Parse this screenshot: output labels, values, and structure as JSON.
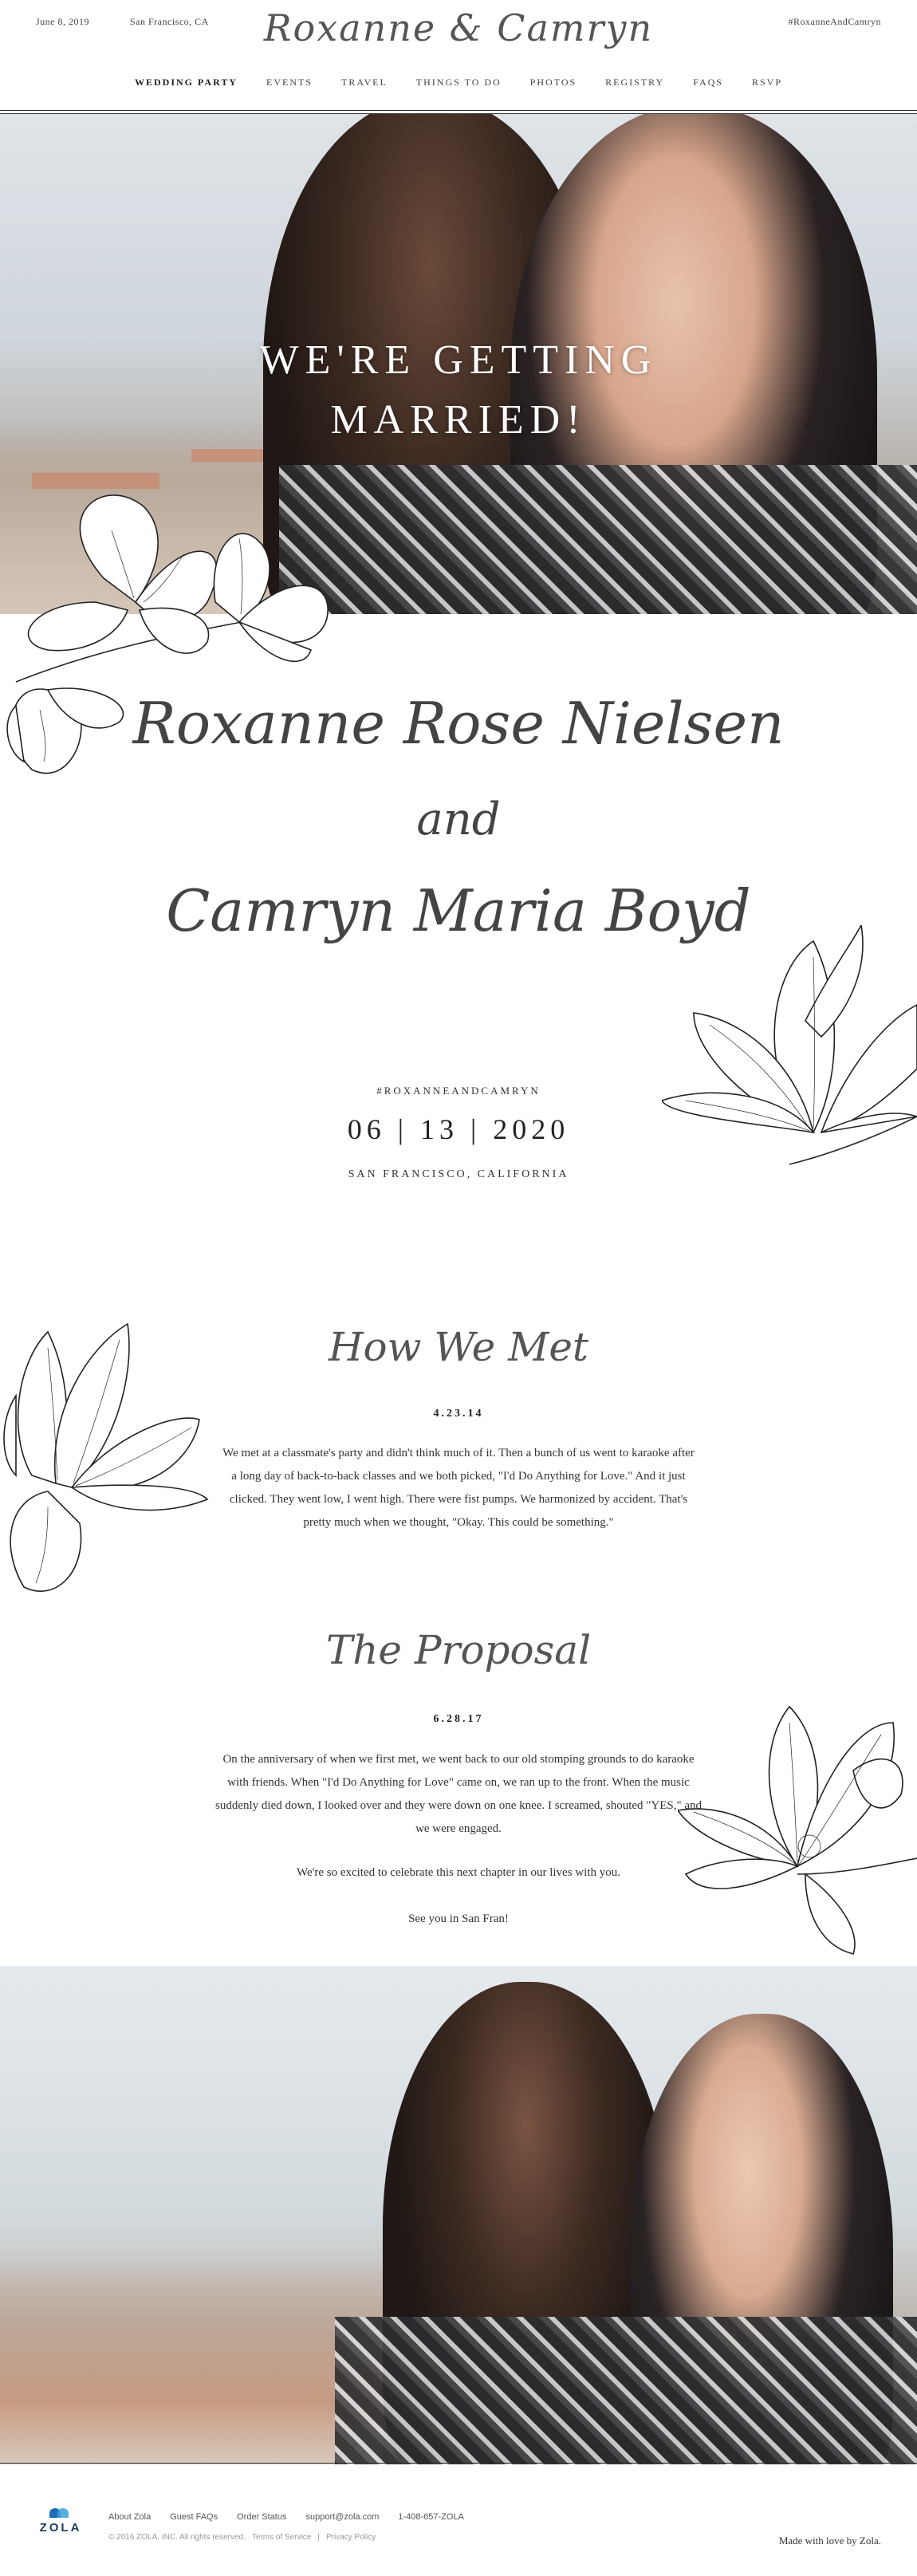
{
  "header": {
    "date": "June 8, 2019",
    "location": "San Francisco, CA",
    "monogram": "Roxanne & Camryn",
    "hashtag": "#RoxanneAndCamryn",
    "nav": [
      {
        "label": "WEDDING PARTY",
        "active": true
      },
      {
        "label": "EVENTS"
      },
      {
        "label": "TRAVEL"
      },
      {
        "label": "THINGS TO DO"
      },
      {
        "label": "PHOTOS"
      },
      {
        "label": "REGISTRY"
      },
      {
        "label": "FAQs"
      },
      {
        "label": "RSVP"
      }
    ]
  },
  "hero": {
    "title_line1": "WE'RE GETTING",
    "title_line2": "MARRIED!"
  },
  "couple": {
    "name_1": "Roxanne Rose Nielsen",
    "and": "and",
    "name_2": "Camryn Maria Boyd",
    "hashtag": "#ROXANNEANDCAMRYN",
    "date": "06 | 13 | 2020",
    "city": "SAN FRANCISCO, CALIFORNIA"
  },
  "story": {
    "how_we_met": {
      "title": "How We Met",
      "date": "4.23.14",
      "text": "We met at a classmate's party and didn't think much of it. Then a bunch of us went to karaoke after a long day of back-to-back classes and we both picked, \"I'd Do Anything for Love.\" And it just clicked. They went low, I went high. There were fist pumps. We harmonized by accident. That's pretty much when we thought, \"Okay. This could be something.\""
    },
    "proposal": {
      "title": "The Proposal",
      "date": "6.28.17",
      "text": "On the anniversary of when we first met, we went back to our old stomping grounds to do karaoke with friends. When \"I'd Do Anything for Love\" came on, we ran up to the front. When the music suddenly died down, I looked over and they were down on one knee. I screamed, shouted \"YES,\" and we were engaged.",
      "closing_1": "We're so excited to celebrate this next chapter in our lives with you.",
      "closing_2": "See you in San Fran!"
    }
  },
  "footer": {
    "logo": "ZOLA",
    "links": [
      "About Zola",
      "Guest FAQs",
      "Order Status",
      "support@zola.com",
      "1-408-657-ZOLA"
    ],
    "copyright": "© 2016 ZOLA, INC. All rights reserved.",
    "terms": "Terms of Service",
    "privacy": "Privacy Policy",
    "made_with": "Made with love by Zola."
  },
  "colors": {
    "text": "#2a2a2a",
    "script": "#555555",
    "zola_blue": "#1b6fb8"
  }
}
